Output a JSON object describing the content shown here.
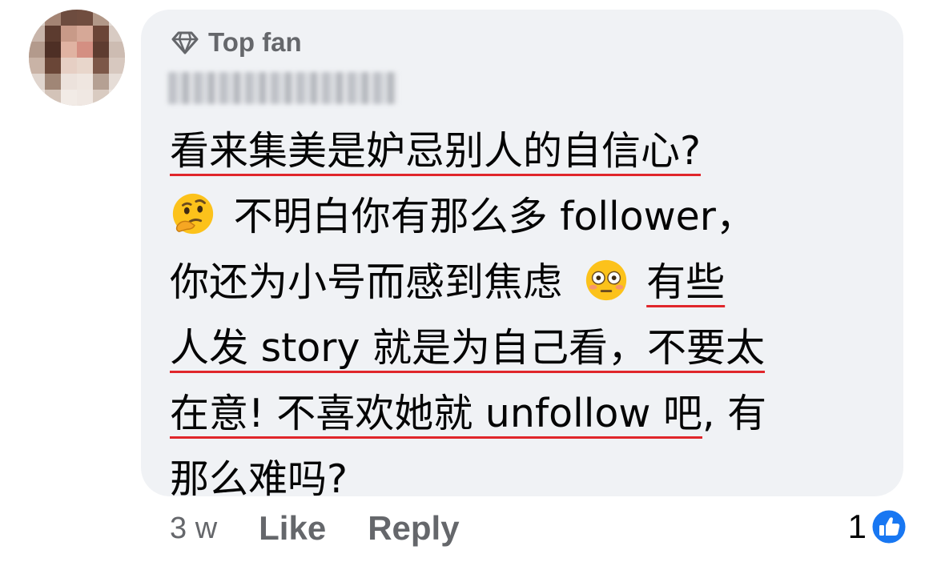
{
  "comment": {
    "badge_label": "Top fan",
    "lines": [
      {
        "text": "看来集美是妒忌别人的自信心?",
        "underline": true,
        "emoji": null
      },
      {
        "text": "不明白你有那么多 follower，",
        "underline": false,
        "emoji": "thinking-face"
      },
      {
        "text": "你还为小号而感到焦虑",
        "underline": false,
        "emoji_after": "flushed-face",
        "tail": "有些",
        "tail_underline": true
      },
      {
        "text": "人发 story 就是为自己看，不要太",
        "underline": true
      },
      {
        "text": "在意! 不喜欢她就 unfollow 吧",
        "underline": true,
        "tail": ", 有",
        "tail_underline": false
      },
      {
        "text": "那么难吗?",
        "underline": false
      }
    ]
  },
  "footer": {
    "timestamp": "3 w",
    "like_label": "Like",
    "reply_label": "Reply"
  },
  "reactions": {
    "count": "1",
    "icon": "like-thumbs-up",
    "color": "#1877f2"
  }
}
